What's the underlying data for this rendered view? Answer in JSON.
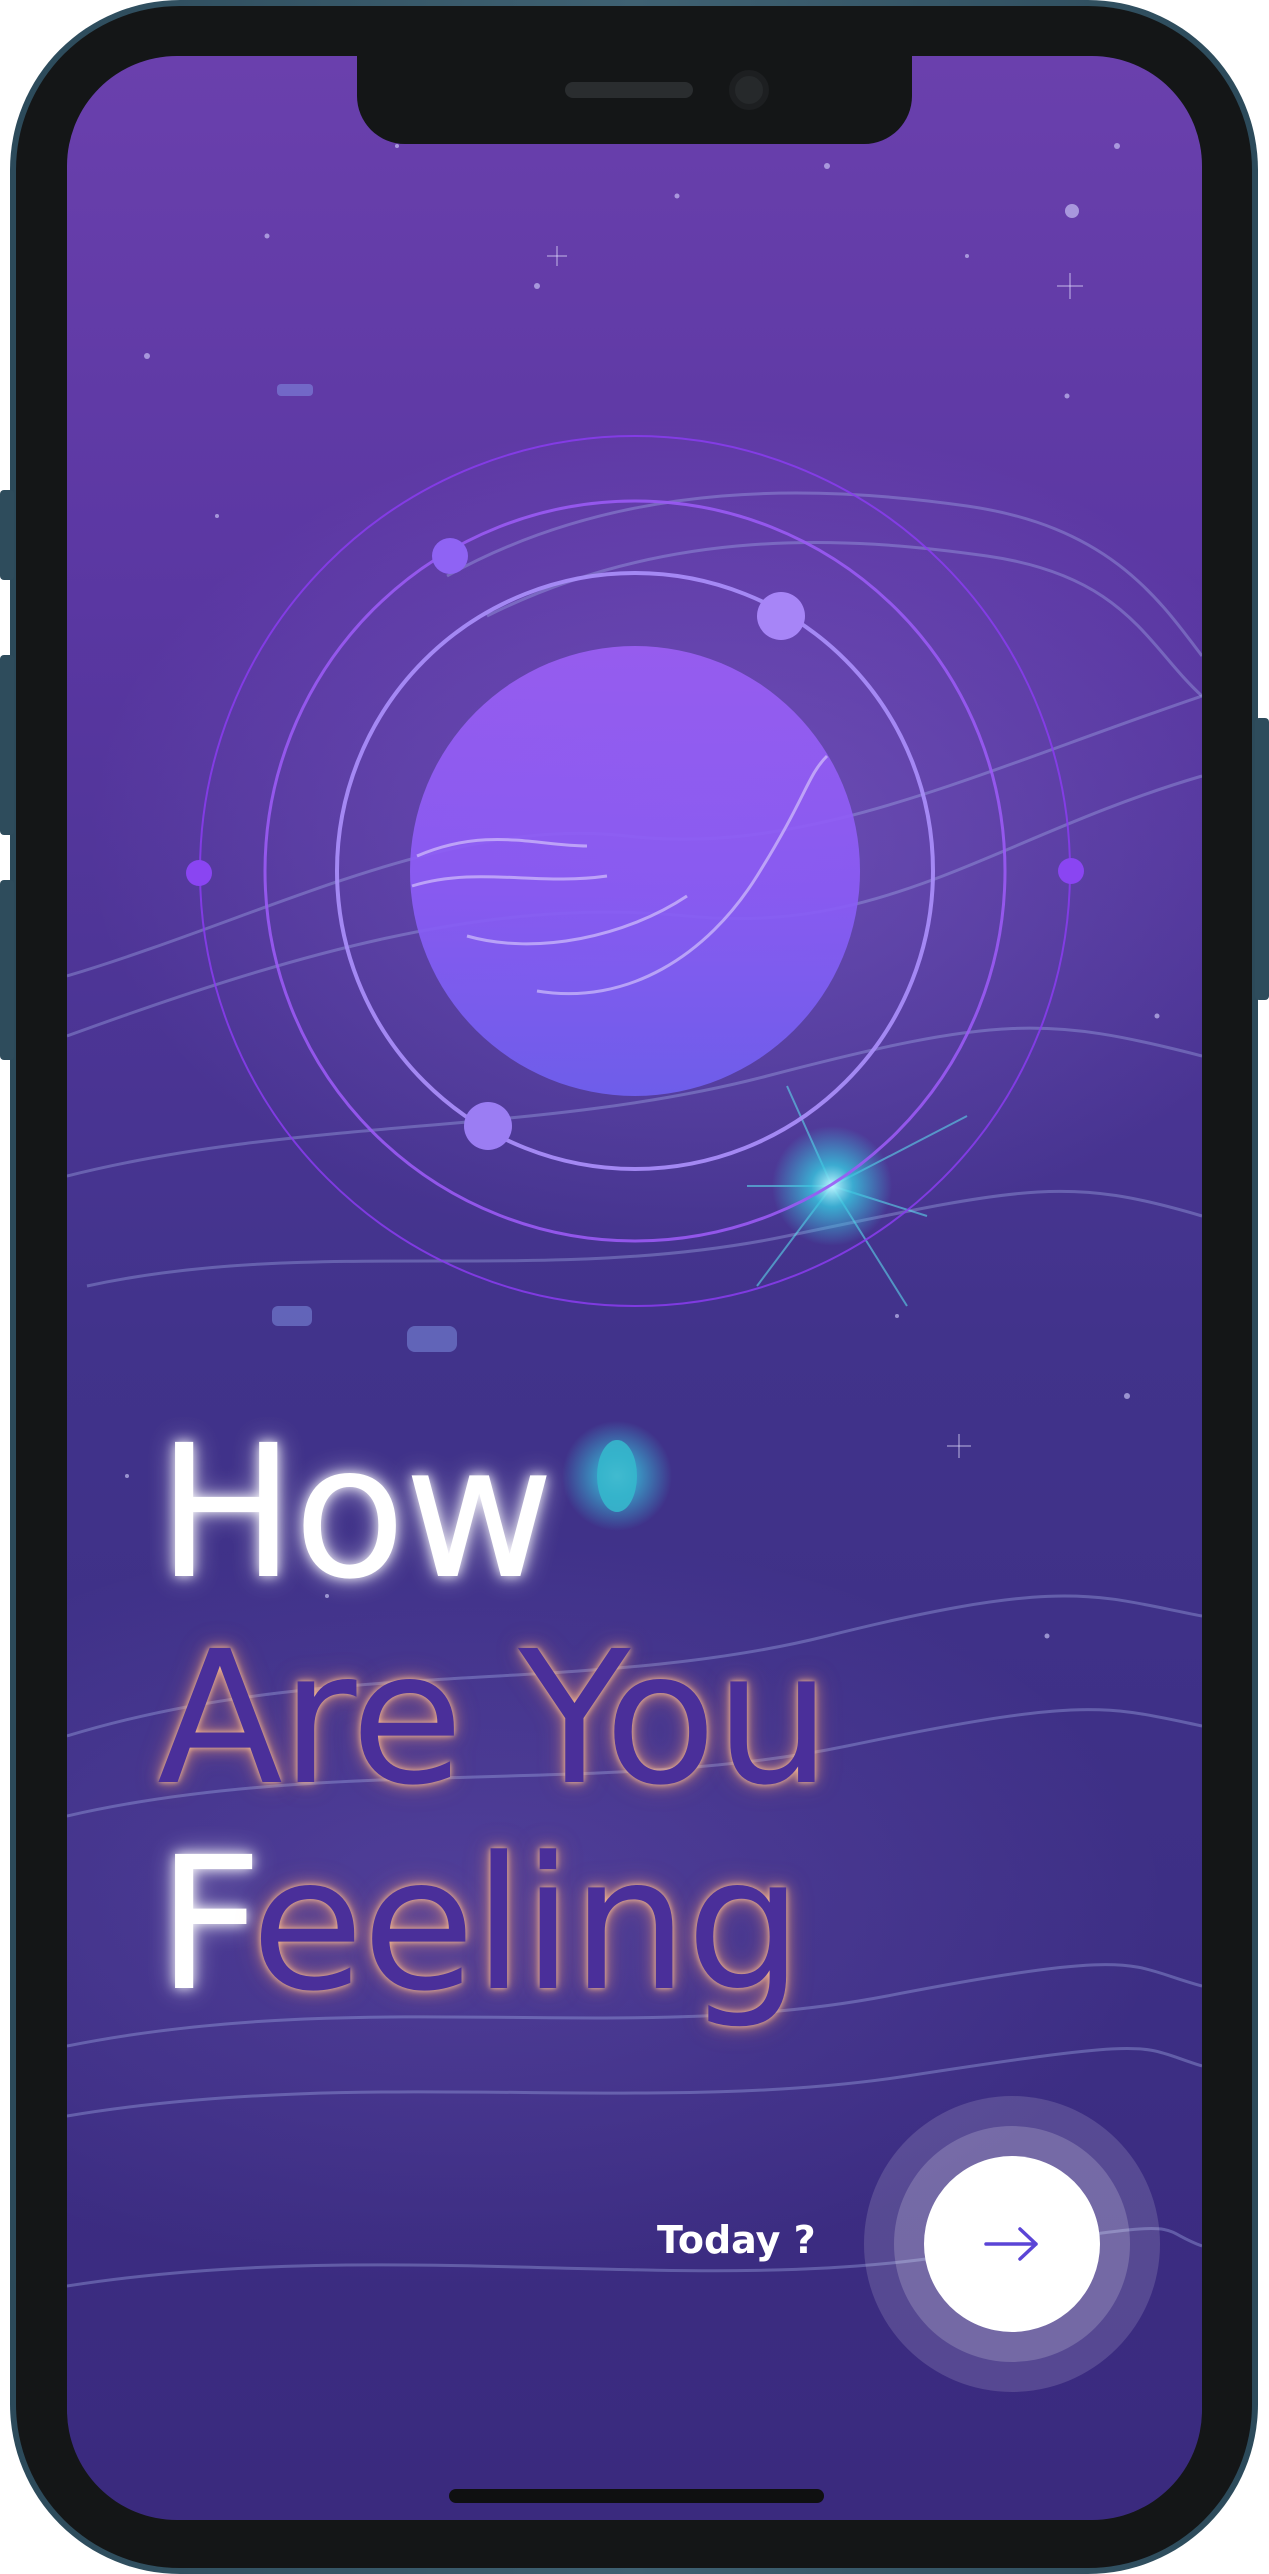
{
  "headline": {
    "word_how": "How",
    "line_are_you": "Are You",
    "letter_f": "F",
    "letters_eeling": "eeling"
  },
  "cta": {
    "prompt_text": "Today ?",
    "next_icon": "arrow-right-icon"
  },
  "colors": {
    "background_top": "#6a40ad",
    "background_bottom": "#3a2a7e",
    "planet": "#8b5cf6",
    "orbit": "#8a55f0",
    "headline_white": "#ffffff",
    "headline_purple": "#4a2f9a",
    "headline_glow": "#ffb48a",
    "arrow": "#5b45d6"
  }
}
